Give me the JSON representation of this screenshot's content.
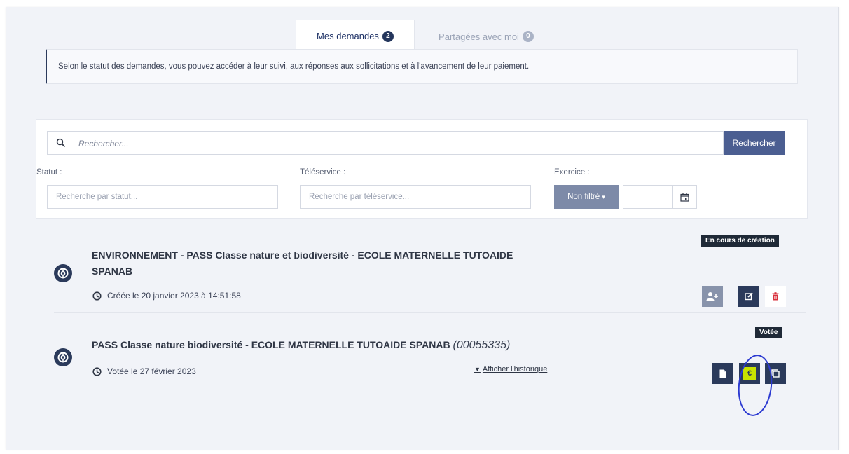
{
  "tabs": [
    {
      "label": "Mes demandes",
      "count": "2"
    },
    {
      "label": "Partagées avec moi",
      "count": "0"
    }
  ],
  "info": {
    "text": "Selon le statut des demandes, vous pouvez accéder à leur suivi, aux réponses aux sollicitations et à l'avancement de leur paiement."
  },
  "search": {
    "placeholder": "Rechercher...",
    "button_label": "Rechercher"
  },
  "filters": {
    "statut": {
      "label": "Statut :",
      "placeholder": "Recherche par statut..."
    },
    "teleservice": {
      "label": "Téléservice :",
      "placeholder": "Recherche par téléservice..."
    },
    "exercice": {
      "label": "Exercice :",
      "button_label": "Non filtré",
      "year_value": ""
    }
  },
  "requests": [
    {
      "status": "En cours de création",
      "title_line1": "ENVIRONNEMENT - PASS Classe nature et biodiversité - ECOLE MATERNELLE TUTOAIDE",
      "title_line2": "SPANAB",
      "date": "Créée le 20 janvier 2023 à 14:51:58",
      "actions": [
        "add-user-icon",
        "edit-icon",
        "trash-icon"
      ]
    },
    {
      "status": "Votée",
      "title": "PASS Classe nature biodiversité - ECOLE MATERNELLE TUTOAIDE SPANAB",
      "reference": "(00055335)",
      "date": "Votée le 27 février 2023",
      "history_link": "Afficher l'historique",
      "euro_symbol": "€",
      "actions": [
        "document-icon",
        "euro-icon",
        "copy-icon"
      ]
    }
  ],
  "colors": {
    "navy": "#2b3a5b",
    "accent_tab": "#f0a43a",
    "search_button": "#4b5e91",
    "filter_button": "#7d8aa8",
    "delete_red": "#d9313c",
    "euro_highlight": "#c8e200",
    "annotation_blue": "#2c3ad1"
  }
}
